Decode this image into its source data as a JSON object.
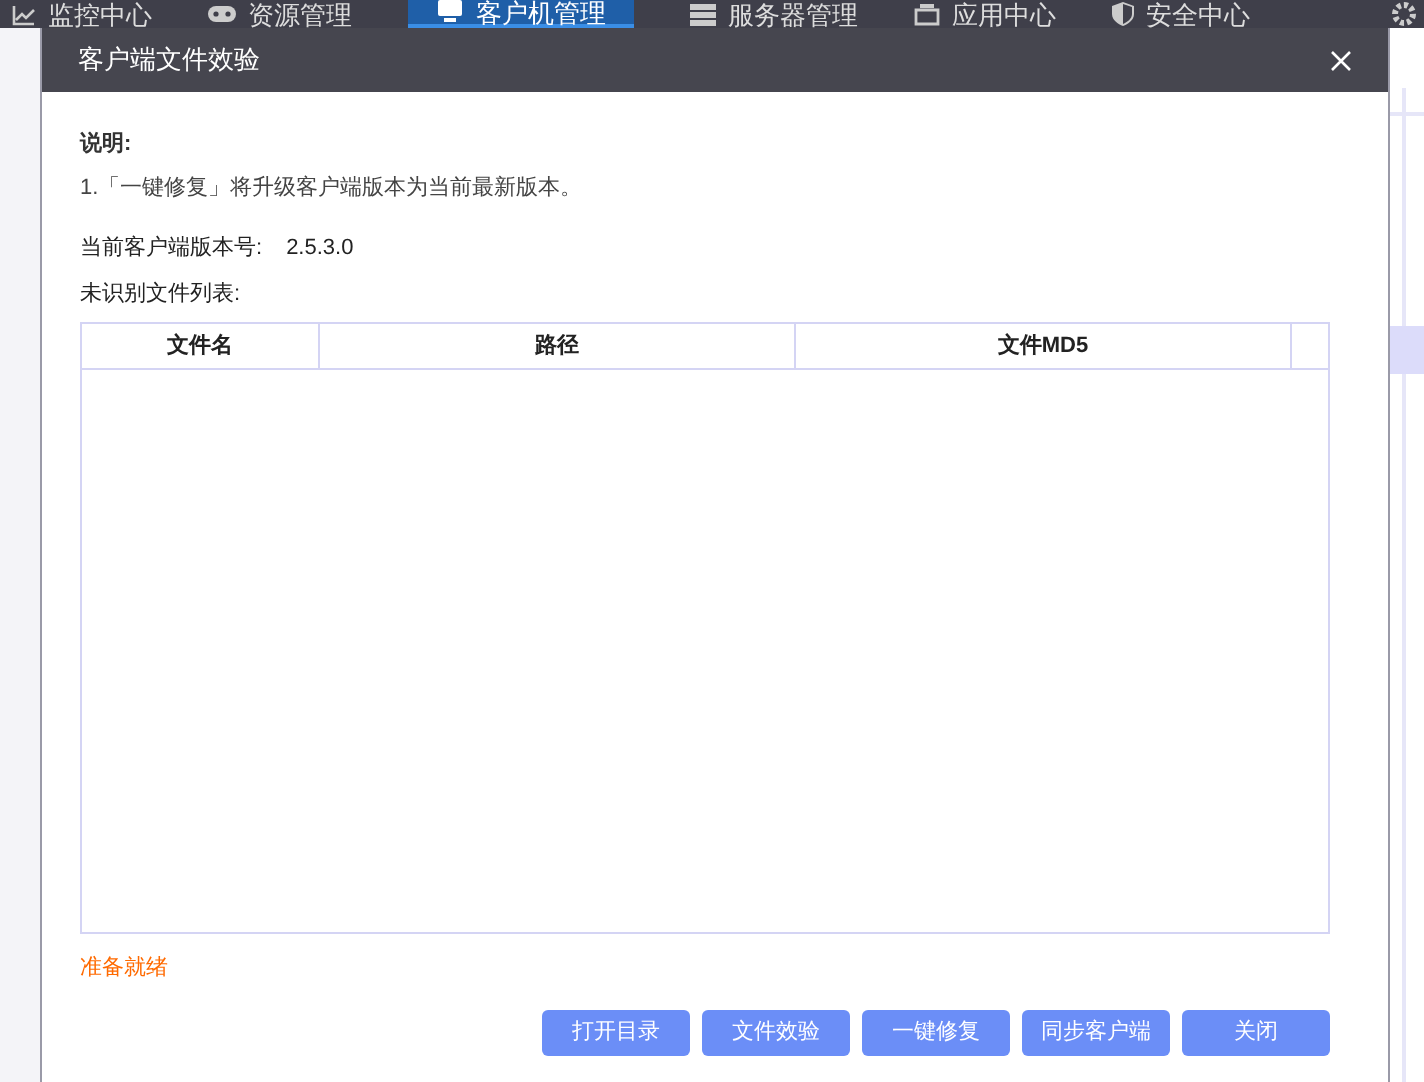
{
  "nav": [
    {
      "label": "监控中心",
      "selected": false
    },
    {
      "label": "资源管理",
      "selected": false
    },
    {
      "label": "客户机管理",
      "selected": true
    },
    {
      "label": "服务器管理",
      "selected": false
    },
    {
      "label": "应用中心",
      "selected": false
    },
    {
      "label": "安全中心",
      "selected": false
    }
  ],
  "dialog": {
    "title": "客户端文件效验",
    "note_heading": "说明:",
    "note": "1.「一键修复」将升级客户端版本为当前最新版本。",
    "version_label": "当前客户端版本号:",
    "version": "2.5.3.0",
    "list_label": "未识别文件列表:",
    "table": {
      "columns": [
        "文件名",
        "路径",
        "文件MD5"
      ]
    },
    "status": "准备就绪",
    "buttons": [
      "打开目录",
      "文件效验",
      "一键修复",
      "同步客户端",
      "关闭"
    ]
  }
}
